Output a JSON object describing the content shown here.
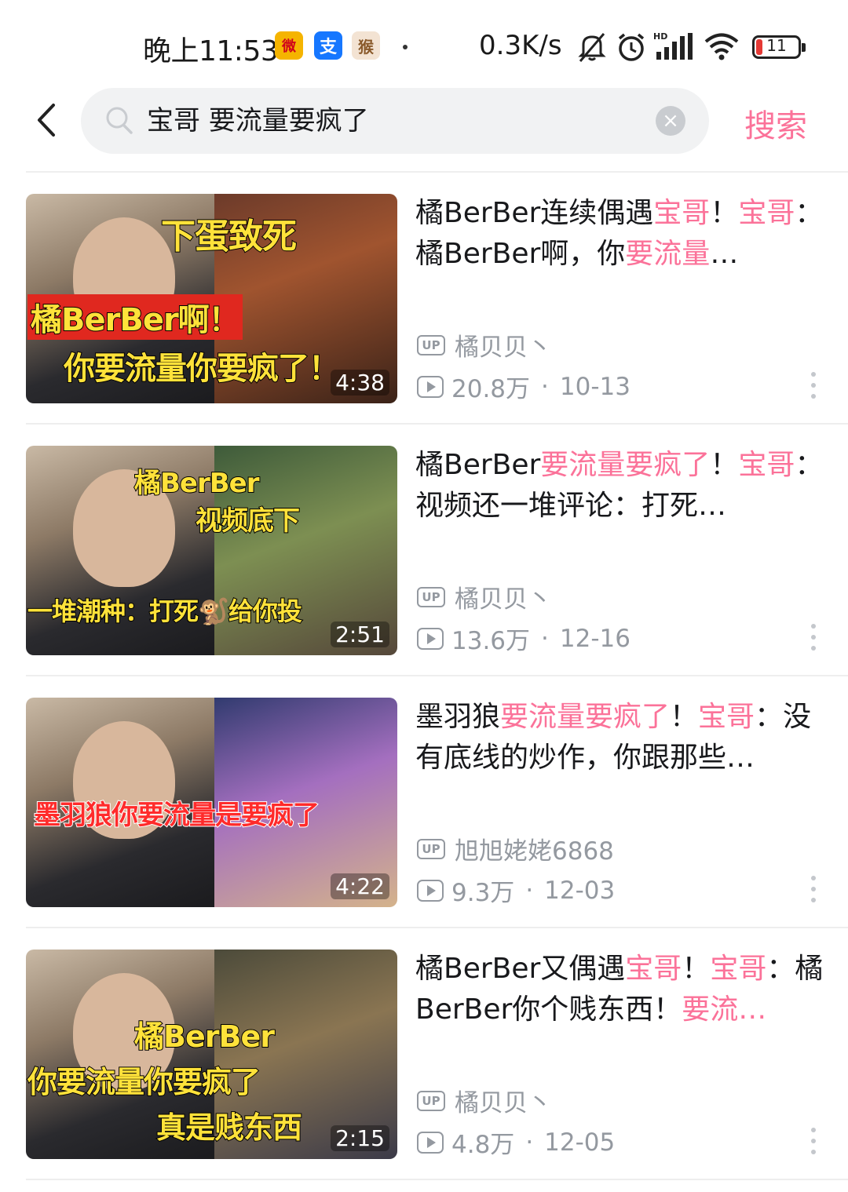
{
  "status_bar": {
    "time": "晚上11:53",
    "net_speed": "0.3K/s",
    "battery": "11",
    "app_icons": [
      "weibo-icon",
      "alipay-icon",
      "monkey-app-icon"
    ],
    "alipay_glyph": "支",
    "weibo_glyph": "微",
    "monkey_glyph": "猴"
  },
  "search": {
    "query": "宝哥 要流量要疯了",
    "submit_label": "搜索",
    "clear_glyph": "×"
  },
  "colors": {
    "accent": "#fb7299",
    "meta": "#9499a0"
  },
  "results": [
    {
      "title_parts": [
        {
          "t": "橘BerBer连续偶遇",
          "hl": false
        },
        {
          "t": "宝哥",
          "hl": true
        },
        {
          "t": "！",
          "hl": false
        },
        {
          "t": "宝哥",
          "hl": true
        },
        {
          "t": "：橘BerBer啊，你",
          "hl": false
        },
        {
          "t": "要流量",
          "hl": true
        },
        {
          "t": "…",
          "hl": false
        }
      ],
      "up_badge": "UP",
      "author": "橘贝贝丶",
      "views": "20.8万",
      "date": "10-13",
      "duration": "4:38",
      "captions": [
        "下蛋致死",
        "橘BerBer啊！",
        "你要流量你要疯了！"
      ]
    },
    {
      "title_parts": [
        {
          "t": "橘BerBer",
          "hl": false
        },
        {
          "t": "要流量要疯了",
          "hl": true
        },
        {
          "t": "！",
          "hl": false
        },
        {
          "t": "宝哥",
          "hl": true
        },
        {
          "t": "：视频还一堆评论：打死…",
          "hl": false
        }
      ],
      "up_badge": "UP",
      "author": "橘贝贝丶",
      "views": "13.6万",
      "date": "12-16",
      "duration": "2:51",
      "captions": [
        "橘BerBer",
        "视频底下",
        "一堆潮种：打死🐒给你投"
      ]
    },
    {
      "title_parts": [
        {
          "t": "墨羽狼",
          "hl": false
        },
        {
          "t": "要流量要疯了",
          "hl": true
        },
        {
          "t": "！",
          "hl": false
        },
        {
          "t": "宝哥",
          "hl": true
        },
        {
          "t": "：没有底线的炒作，你跟那些…",
          "hl": false
        }
      ],
      "up_badge": "UP",
      "author": "旭旭姥姥6868",
      "views": "9.3万",
      "date": "12-03",
      "duration": "4:22",
      "captions": [
        "墨羽狼你要流量是要疯了"
      ]
    },
    {
      "title_parts": [
        {
          "t": "橘BerBer又偶遇",
          "hl": false
        },
        {
          "t": "宝哥",
          "hl": true
        },
        {
          "t": "！",
          "hl": false
        },
        {
          "t": "宝哥",
          "hl": true
        },
        {
          "t": "：橘BerBer你个贱东西！",
          "hl": false
        },
        {
          "t": "要流…",
          "hl": true
        }
      ],
      "up_badge": "UP",
      "author": "橘贝贝丶",
      "views": "4.8万",
      "date": "12-05",
      "duration": "2:15",
      "captions": [
        "橘BerBer",
        "你要流量你要疯了",
        "真是贱东西"
      ]
    }
  ]
}
